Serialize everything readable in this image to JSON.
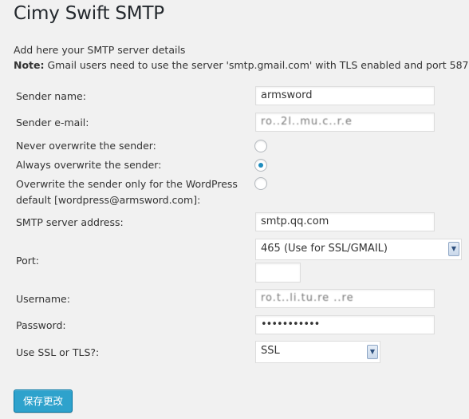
{
  "page": {
    "title": "Cimy Swift SMTP",
    "intro": "Add here your SMTP server details",
    "note_label": "Note:",
    "note_text": " Gmail users need to use the server 'smtp.gmail.com' with TLS enabled and port 587"
  },
  "form": {
    "sender_name": {
      "label": "Sender name:",
      "value": "armsword"
    },
    "sender_email": {
      "label": "Sender e-mail:",
      "value": "ro..2l..mu.c..r.e"
    },
    "never_overwrite": {
      "label": "Never overwrite the sender:",
      "checked": false
    },
    "always_overwrite": {
      "label": "Always overwrite the sender:",
      "checked": true
    },
    "overwrite_wp": {
      "label_line1": "Overwrite the sender only for the WordPress",
      "label_line2": "default [wordpress@armsword.com]:",
      "checked": false
    },
    "smtp_server": {
      "label": "SMTP server address:",
      "value": "smtp.qq.com"
    },
    "port": {
      "label": "Port:",
      "selected": "465 (Use for SSL/GMAIL)",
      "custom_value": ""
    },
    "username": {
      "label": "Username:",
      "value": "ro.t..li.tu.re ..re"
    },
    "password": {
      "label": "Password:",
      "value": "•••••••••••"
    },
    "ssl": {
      "label": "Use SSL or TLS?:",
      "selected": "SSL"
    }
  },
  "actions": {
    "save_label": "保存更改"
  },
  "colors": {
    "accent": "#2ea2cc",
    "radio_dot": "#1e8cbe",
    "background": "#f1f1f1"
  }
}
